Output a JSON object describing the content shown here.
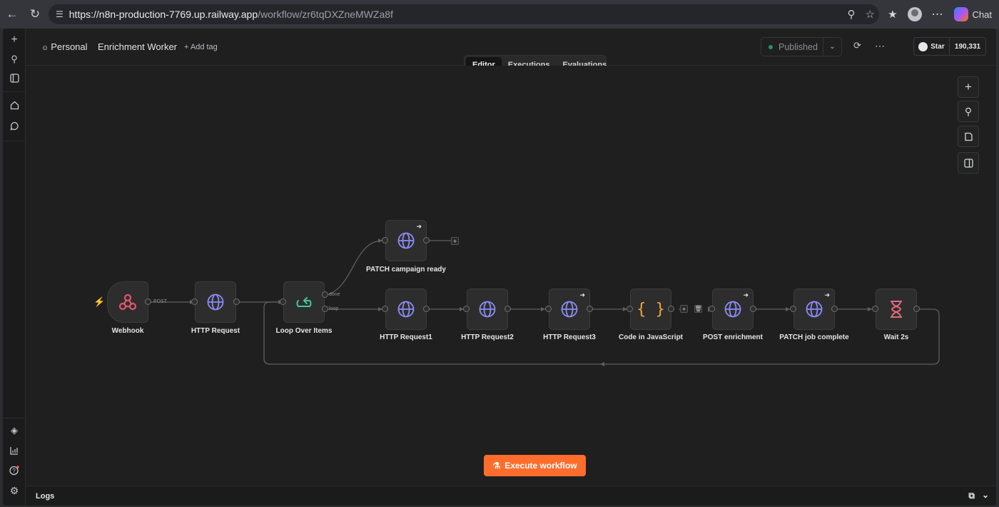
{
  "browser": {
    "url_host": "https://n8n-production-7769.up.railway.app",
    "url_path": "/workflow/zr6tqDXZneMWZa8f",
    "chat_label": "Chat"
  },
  "header": {
    "project": "Personal",
    "workflow_name": "Enrichment Worker",
    "add_tag": "+ Add tag",
    "published": "Published",
    "star_label": "Star",
    "star_count": "190,331"
  },
  "tabs": [
    {
      "label": "Editor",
      "active": true
    },
    {
      "label": "Executions",
      "active": false
    },
    {
      "label": "Evaluations",
      "active": false
    }
  ],
  "nodes": {
    "webhook": "Webhook",
    "http_request": "HTTP Request",
    "loop_over_items": "Loop Over Items",
    "patch_campaign_ready": "PATCH campaign ready",
    "http_request1": "HTTP Request1",
    "http_request2": "HTTP Request2",
    "http_request3": "HTTP Request3",
    "code_js": "Code in JavaScript",
    "post_enrichment": "POST enrichment",
    "patch_job_complete": "PATCH job complete",
    "wait_2s": "Wait 2s"
  },
  "edge_labels": {
    "post": "POST",
    "done": "done",
    "loop": "loop"
  },
  "execute_button": "Execute workflow",
  "logs_label": "Logs",
  "colors": {
    "accent": "#ff6d2c",
    "globe": "#8b8cf6",
    "webhook": "#e0566d",
    "loop": "#3fc7a3",
    "code": "#f2a43a",
    "wait": "#e36a7e"
  }
}
